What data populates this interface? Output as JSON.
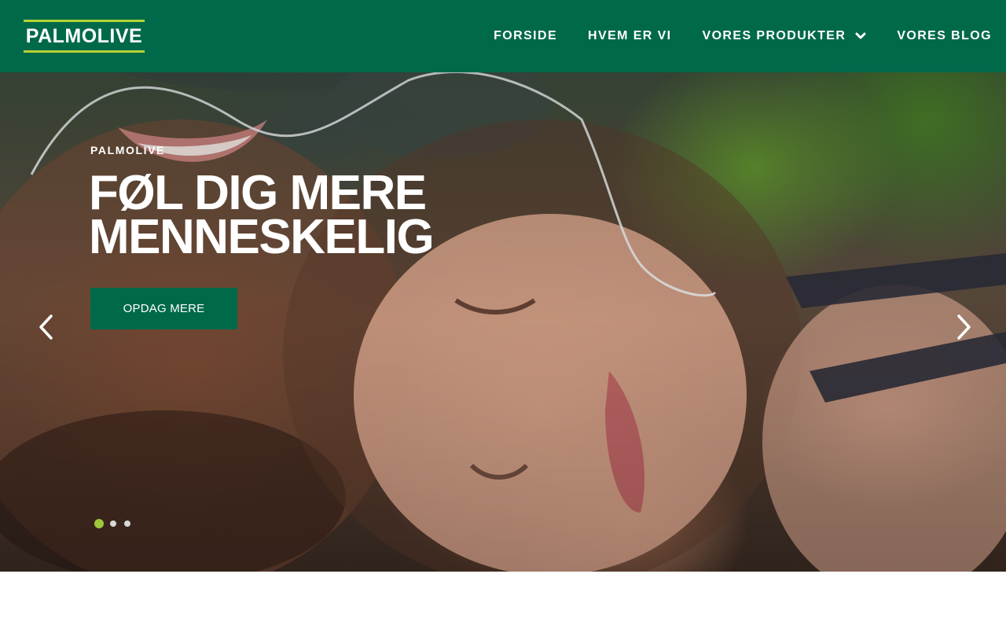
{
  "header": {
    "logo_text": "PALMOLIVE",
    "nav": [
      {
        "label": "FORSIDE"
      },
      {
        "label": "HVEM ER VI"
      },
      {
        "label": "VORES PRODUKTER",
        "icon": "chevron-down-icon"
      },
      {
        "label": "VORES BLOG"
      }
    ]
  },
  "hero": {
    "eyebrow": "PALMOLIVE",
    "headline_line1": "FØL DIG MERE",
    "headline_line2": "MENNESKELIG",
    "cta_label": "OPDAG MERE",
    "prev_icon": "chevron-left-icon",
    "next_icon": "chevron-right-icon",
    "slides_total": 3,
    "active_slide": 1
  },
  "colors": {
    "brand_green": "#00694a",
    "accent_lime": "#b5d334",
    "dot_active": "#9ec73c",
    "dot_inactive": "#d8d8d8"
  }
}
